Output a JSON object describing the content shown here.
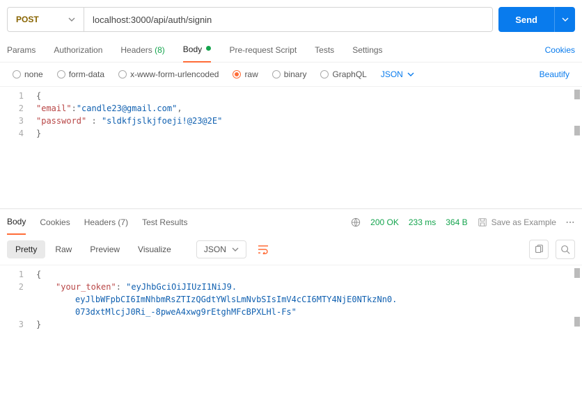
{
  "request": {
    "method": "POST",
    "url": "localhost:3000/api/auth/signin",
    "sendLabel": "Send"
  },
  "reqTabs": {
    "params": "Params",
    "authorization": "Authorization",
    "headers": "Headers",
    "headersCount": "(8)",
    "body": "Body",
    "preRequest": "Pre-request Script",
    "tests": "Tests",
    "settings": "Settings",
    "cookies": "Cookies"
  },
  "bodyTypes": {
    "none": "none",
    "formData": "form-data",
    "urlencoded": "x-www-form-urlencoded",
    "raw": "raw",
    "binary": "binary",
    "graphql": "GraphQL",
    "rawFormat": "JSON",
    "beautify": "Beautify"
  },
  "reqBody": {
    "lines": [
      "1",
      "2",
      "3",
      "4"
    ],
    "l1_open": "{",
    "l2_key": "\"email\"",
    "l2_colon": ":",
    "l2_val": "\"candle23@gmail.com\"",
    "l2_comma": ",",
    "l3_key": "\"password\"",
    "l3_colon": " : ",
    "l3_val": "\"sldkfjslkjfoeji!@23@2E\"",
    "l4_close": "}"
  },
  "respTabs": {
    "body": "Body",
    "cookies": "Cookies",
    "headers": "Headers",
    "headersCount": "(7)",
    "testResults": "Test Results",
    "status": "200 OK",
    "time": "233 ms",
    "size": "364 B",
    "saveExample": "Save as Example"
  },
  "respView": {
    "pretty": "Pretty",
    "raw": "Raw",
    "preview": "Preview",
    "visualize": "Visualize",
    "format": "JSON"
  },
  "respBody": {
    "lines": [
      "1",
      "2",
      "3"
    ],
    "l1_open": "{",
    "l2_key": "\"your_token\"",
    "l2_colon": ": ",
    "l2_val1": "\"eyJhbGciOiJIUzI1NiJ9.",
    "l2_val2": "eyJlbWFpbCI6ImNhbmRsZTIzQGdtYWlsLmNvbSIsImV4cCI6MTY4NjE0NTkzNn0.",
    "l2_val3": "073dxtMlcjJ0Ri_-8pweA4xwg9rEtghMFcBPXLHl-Fs\"",
    "l3_close": "}"
  }
}
